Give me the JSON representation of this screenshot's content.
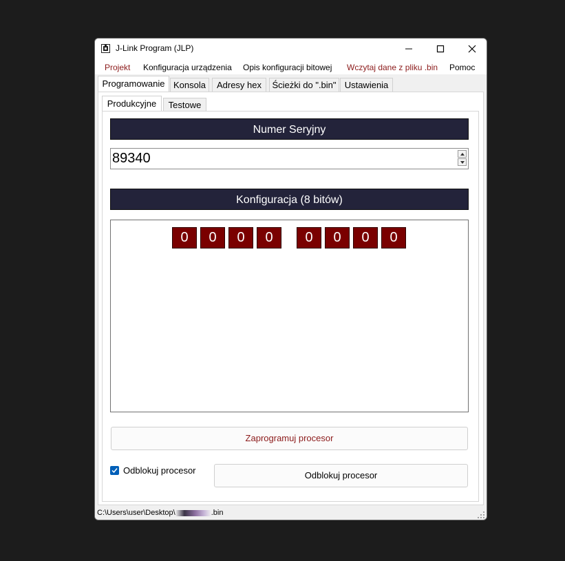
{
  "window": {
    "title": "J-Link Program (JLP)",
    "icon": "app-icon"
  },
  "menu": [
    "Projekt",
    "Konfiguracja urządzenia",
    "Opis konfiguracji bitowej",
    "Wczytaj dane z pliku .bin",
    "Pomoc"
  ],
  "tabs": [
    "Programowanie",
    "Konsola",
    "Adresy hex",
    "Ścieżki do \".bin\"",
    "Ustawienia"
  ],
  "sub_tabs": [
    "Produkcyjne",
    "Testowe"
  ],
  "serial": {
    "header": "Numer Seryjny",
    "value": "89340"
  },
  "config": {
    "header": "Konfiguracja (8 bitów)",
    "bits": [
      "0",
      "0",
      "0",
      "0",
      "0",
      "0",
      "0",
      "0"
    ]
  },
  "buttons": {
    "program": "Zaprogramuj procesor",
    "unlock": "Odblokuj procesor"
  },
  "unlock_checkbox": {
    "label": "Odblokuj procesor",
    "checked": true
  },
  "status": {
    "path_prefix": "C:\\Users\\user\\Desktop\\",
    "path_suffix": ".bin"
  },
  "colors": {
    "header_bg": "#23233a",
    "bit_bg": "#7a0000",
    "accent_red_text": "#8b1a1a",
    "checkbox": "#005fb8"
  }
}
